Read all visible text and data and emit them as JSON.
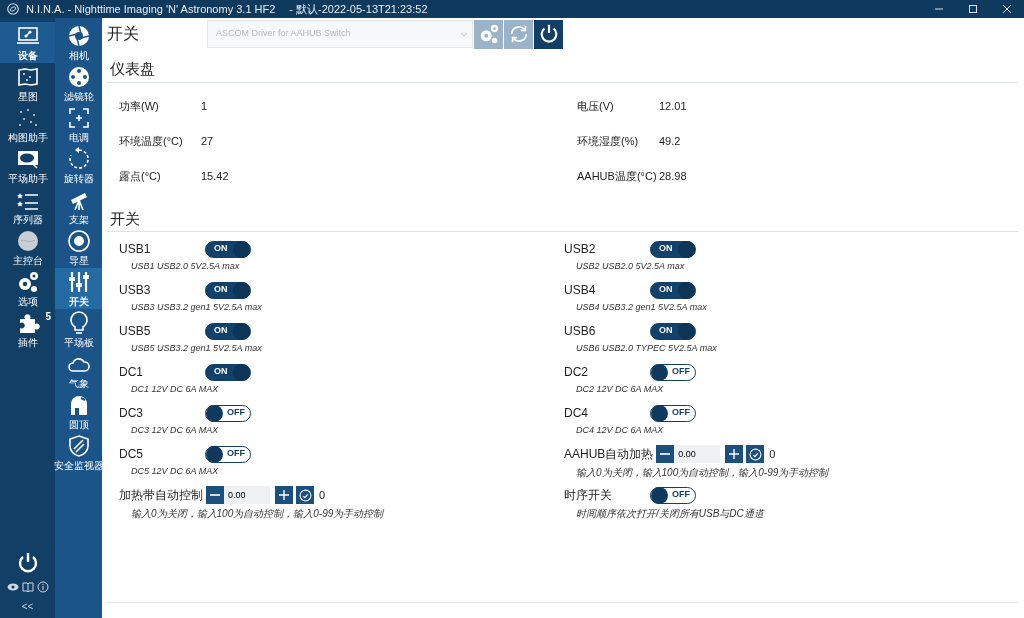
{
  "window": {
    "title": "N.I.N.A. - Nighttime Imaging 'N' Astronomy 3.1 HF2",
    "profile": "-  默认-2022-05-13T21:23:52"
  },
  "nav_primary": [
    {
      "label": "设备",
      "selected": true
    },
    {
      "label": "星图",
      "selected": false
    },
    {
      "label": "构图助手",
      "selected": false
    },
    {
      "label": "平场助手",
      "selected": false
    },
    {
      "label": "序列器",
      "selected": false
    },
    {
      "label": "主控台",
      "selected": false
    },
    {
      "label": "选项",
      "selected": false
    },
    {
      "label": "插件",
      "selected": false,
      "badge": "5"
    }
  ],
  "nav_secondary": [
    {
      "label": "相机",
      "selected": false
    },
    {
      "label": "滤镜轮",
      "selected": false
    },
    {
      "label": "电调",
      "selected": false
    },
    {
      "label": "旋转器",
      "selected": false
    },
    {
      "label": "支架",
      "selected": false
    },
    {
      "label": "导星",
      "selected": false
    },
    {
      "label": "开关",
      "selected": true
    },
    {
      "label": "平场板",
      "selected": false
    },
    {
      "label": "气象",
      "selected": false
    },
    {
      "label": "圆顶",
      "selected": false
    },
    {
      "label": "安全监视器",
      "selected": false
    }
  ],
  "nav_footer": {
    "collapse": "<<"
  },
  "header": {
    "title": "开关",
    "driver": "ASCOM Driver for AAHUB Switch",
    "connected": true
  },
  "dashboard": {
    "title": "仪表盘",
    "readings": [
      {
        "label": "功率(W)",
        "value": "1"
      },
      {
        "label": "电压(V)",
        "value": "12.01"
      },
      {
        "label": "环境温度(°C)",
        "value": "27"
      },
      {
        "label": "环境湿度(%)",
        "value": "49.2"
      },
      {
        "label": "露点(°C)",
        "value": "15.42"
      },
      {
        "label": "AAHUB温度(°C)",
        "value": "28.98"
      }
    ]
  },
  "switches": {
    "title": "开关",
    "items": [
      {
        "kind": "toggle",
        "label": "USB1",
        "on": true,
        "text": "ON",
        "description": "USB1 USB2.0 5V2.5A max"
      },
      {
        "kind": "toggle",
        "label": "USB2",
        "on": true,
        "text": "ON",
        "description": "USB2 USB2.0 5V2.5A max"
      },
      {
        "kind": "toggle",
        "label": "USB3",
        "on": true,
        "text": "ON",
        "description": "USB3 USB3.2 gen1 5V2.5A max"
      },
      {
        "kind": "toggle",
        "label": "USB4",
        "on": true,
        "text": "ON",
        "description": "USB4 USB3.2 gen1 5V2.5A max"
      },
      {
        "kind": "toggle",
        "label": "USB5",
        "on": true,
        "text": "ON",
        "description": "USB5 USB3.2 gen1 5V2.5A max"
      },
      {
        "kind": "toggle",
        "label": "USB6",
        "on": true,
        "text": "ON",
        "description": "USB6 USB2.0 TYPEC 5V2.5A max"
      },
      {
        "kind": "toggle",
        "label": "DC1",
        "on": true,
        "text": "ON",
        "description": "DC1 12V DC 6A MAX"
      },
      {
        "kind": "toggle",
        "label": "DC2",
        "on": false,
        "text": "OFF",
        "description": "DC2 12V DC 6A MAX"
      },
      {
        "kind": "toggle",
        "label": "DC3",
        "on": false,
        "text": "OFF",
        "description": "DC3 12V DC 6A MAX"
      },
      {
        "kind": "toggle",
        "label": "DC4",
        "on": false,
        "text": "OFF",
        "description": "DC4 12V DC 6A MAX"
      },
      {
        "kind": "toggle",
        "label": "DC5",
        "on": false,
        "text": "OFF",
        "description": "DC5 12V DC 6A MAX"
      },
      {
        "kind": "heater",
        "label": "AAHUB自动加热",
        "value": "0.00",
        "reading": "0",
        "description": "输入0为关闭，输入100为自动控制，输入0-99为手动控制"
      },
      {
        "kind": "heater",
        "label": "加热带自动控制",
        "value": "0.00",
        "reading": "0",
        "description": "输入0为关闭，输入100为自动控制，输入0-99为手动控制"
      },
      {
        "kind": "toggle",
        "label": "时序开关",
        "on": false,
        "text": "OFF",
        "description": "时间顺序依次打开/关闭所有USB与DC通道"
      }
    ]
  }
}
